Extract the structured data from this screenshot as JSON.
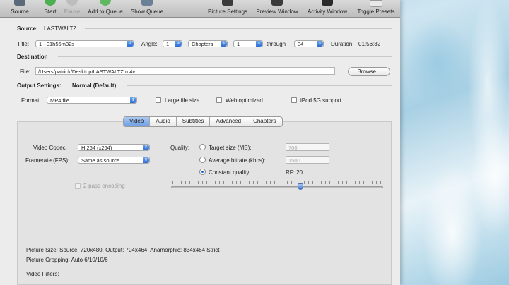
{
  "toolbar": {
    "source": "Source",
    "start": "Start",
    "pause": "Pause",
    "add_to_queue": "Add to Queue",
    "show_queue": "Show Queue",
    "picture_settings": "Picture Settings",
    "preview_window": "Preview Window",
    "activity_window": "Activity Window",
    "toggle_presets": "Toggle Presets"
  },
  "source": {
    "label": "Source:",
    "value": "LASTWALTZ",
    "title_label": "Title:",
    "title_value": "1 - 01h56m32s",
    "angle_label": "Angle:",
    "angle_value": "1",
    "range_type": "Chapters",
    "range_start": "1",
    "through_label": "through",
    "range_end": "34",
    "duration_label": "Duration:",
    "duration_value": "01:56:32"
  },
  "destination": {
    "header": "Destination",
    "file_label": "File:",
    "file_value": "/Users/patrick/Desktop/LASTWALTZ.m4v",
    "browse": "Browse..."
  },
  "output": {
    "label": "Output Settings:",
    "preset": "Normal (Default)",
    "format_label": "Format:",
    "format_value": "MP4 file",
    "large_file": "Large file size",
    "web_optimized": "Web optimized",
    "ipod": "iPod 5G support"
  },
  "tabs": [
    "Video",
    "Audio",
    "Subtitles",
    "Advanced",
    "Chapters"
  ],
  "video": {
    "codec_label": "Video Codec:",
    "codec_value": "H.264 (x264)",
    "framerate_label": "Framerate (FPS):",
    "framerate_value": "Same as source",
    "two_pass": "2-pass encoding",
    "quality_label": "Quality:",
    "target_size_label": "Target size (MB):",
    "target_size_value": "700",
    "avg_bitrate_label": "Average bitrate (kbps):",
    "avg_bitrate_value": "1500",
    "constant_quality_label": "Constant quality:",
    "rf_label": "RF: 20",
    "quality_slider_fraction": 0.61
  },
  "info": {
    "picture_size": "Picture Size: Source: 720x480, Output: 704x464, Anamorphic: 834x464 Strict",
    "picture_cropping": "Picture Cropping: Auto 6/10/10/6",
    "video_filters": "Video Filters:"
  },
  "colors": {
    "accent": "#3b78d8",
    "start_icon": "#4caf50",
    "add_queue_icon": "#5fb85f"
  }
}
